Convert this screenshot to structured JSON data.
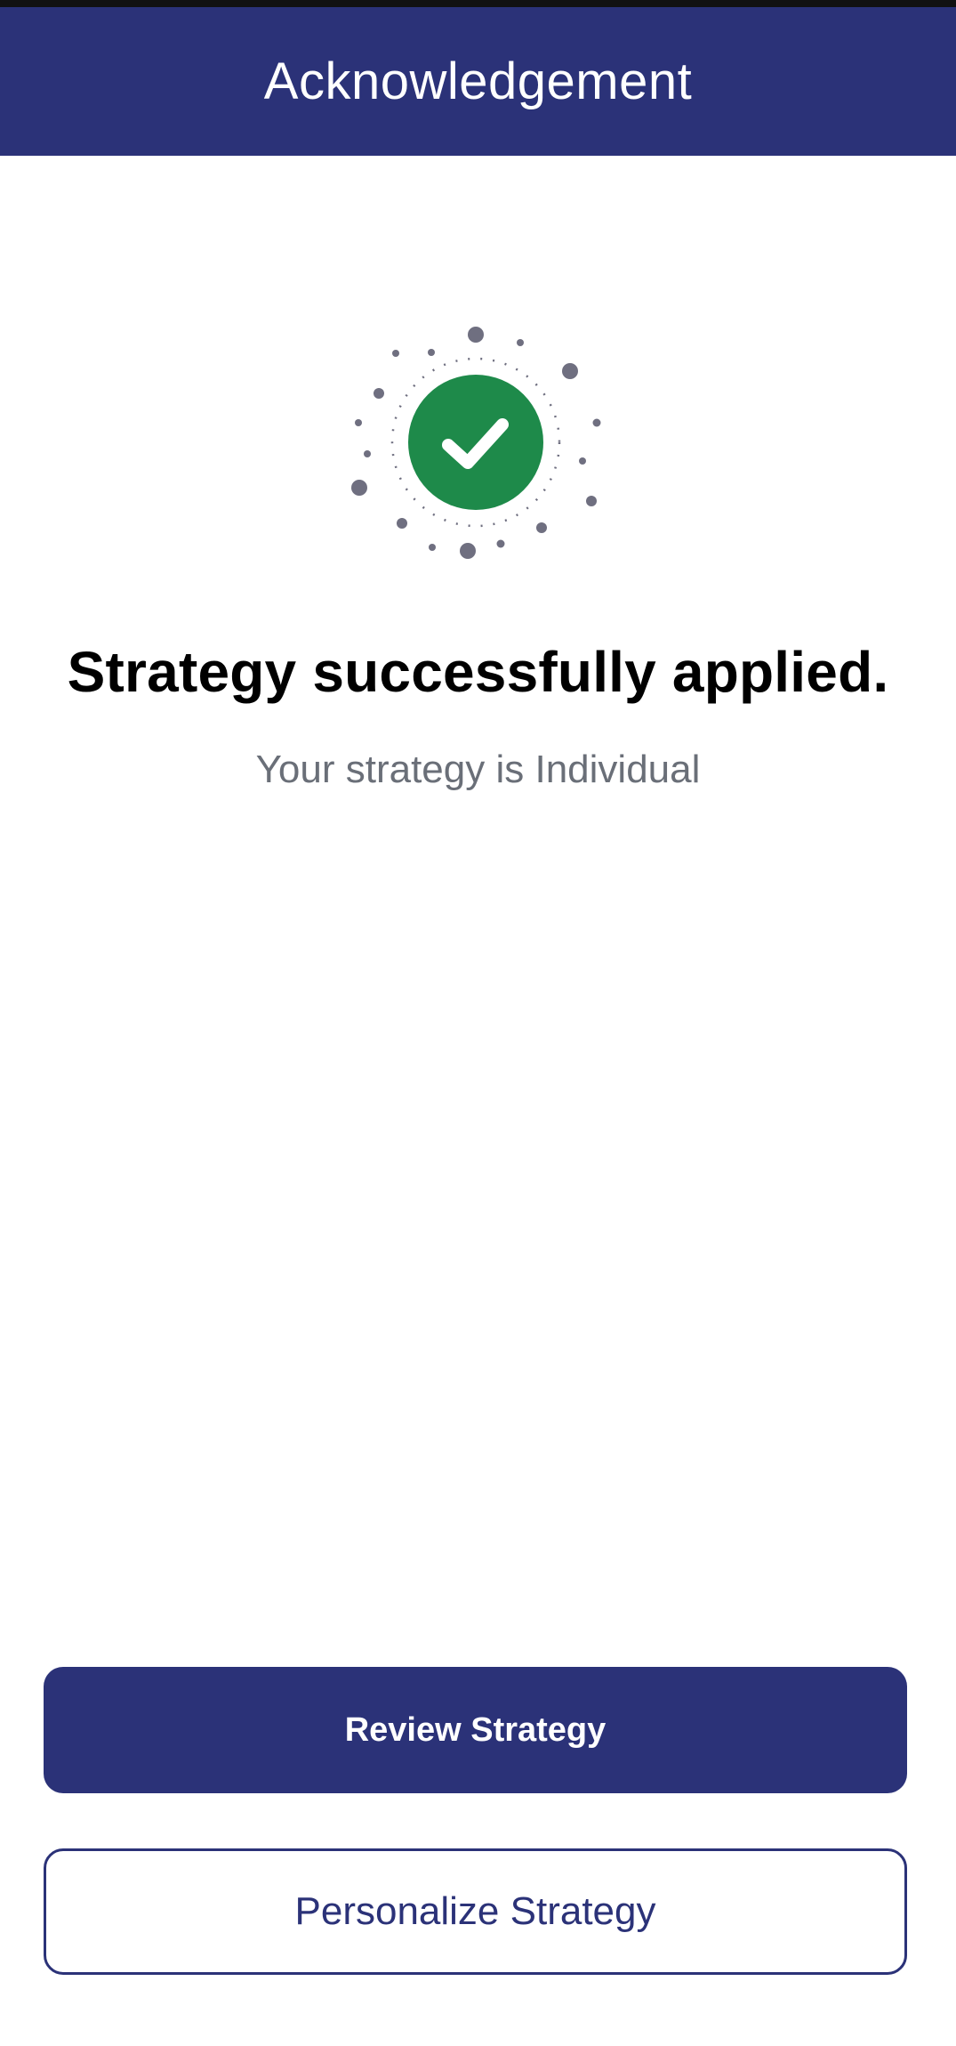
{
  "header": {
    "title": "Acknowledgement"
  },
  "confirmation": {
    "headline": "Strategy successfully applied.",
    "subtitle": "Your strategy is Individual",
    "icon": "check-circle-icon"
  },
  "actions": {
    "primary_label": "Review Strategy",
    "secondary_label": "Personalize Strategy"
  },
  "colors": {
    "brand": "#2b3278",
    "success": "#1e8a4a",
    "dots": "#6f6f80",
    "subtitle": "#6a6f78"
  }
}
